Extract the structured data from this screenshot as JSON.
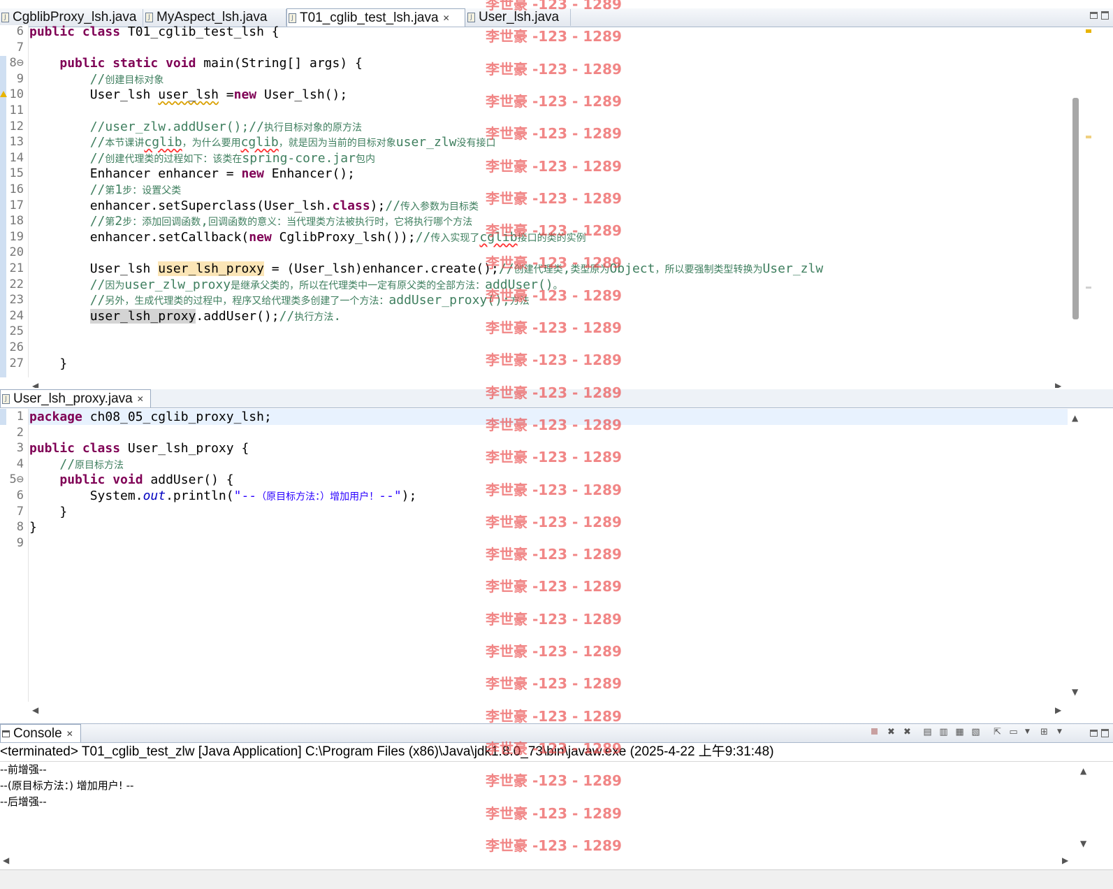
{
  "editor_tabs": [
    {
      "label": "CgblibProxy_lsh.java",
      "active": false
    },
    {
      "label": "MyAspect_lsh.java",
      "active": false
    },
    {
      "label": "T01_cglib_test_lsh.java",
      "active": true
    },
    {
      "label": "User_lsh.java",
      "active": false
    }
  ],
  "editor1": {
    "lines": [
      {
        "n": "6",
        "html": "<span class=\"kw\">public class</span> T01_cglib_test_lsh {"
      },
      {
        "n": "7",
        "html": ""
      },
      {
        "n": "8⊖",
        "html": "    <span class=\"kw\">public static void</span> main(String[] args) {"
      },
      {
        "n": "9",
        "html": "        <span class=\"cm\">//</span><span class=\"cmc\">创建目标对象</span>"
      },
      {
        "n": "10",
        "html": "        User_lsh <span class=\"squig\">user_lsh</span> =<span class=\"kw\">new</span> User_lsh();"
      },
      {
        "n": "11",
        "html": ""
      },
      {
        "n": "12",
        "html": "        <span class=\"cm\">//user_zlw.addUser();//</span><span class=\"cmc\">执行目标对象的原方法</span>"
      },
      {
        "n": "13",
        "html": "        <span class=\"cm\">//</span><span class=\"cmc\">本节课讲</span><span class=\"cm squigr\">cglib</span><span class=\"cmc\">，为什么要用</span><span class=\"cm squigr\">cglib</span><span class=\"cmc\">，就是因为当前的目标对象</span><span class=\"cm\">user_zlw</span><span class=\"cmc\">没有接口</span>"
      },
      {
        "n": "14",
        "html": "        <span class=\"cm\">//</span><span class=\"cmc\">创建代理类的过程如下：该类在</span><span class=\"cm\">spring-core.jar</span><span class=\"cmc\">包内</span>"
      },
      {
        "n": "15",
        "html": "        Enhancer enhancer = <span class=\"kw\">new</span> Enhancer();"
      },
      {
        "n": "16",
        "html": "        <span class=\"cm\">//</span><span class=\"cmc\">第</span><span class=\"cm\">1</span><span class=\"cmc\">步：设置父类</span>"
      },
      {
        "n": "17",
        "html": "        enhancer.setSuperclass(User_lsh.<span class=\"kw\">class</span>);<span class=\"cm\">//</span><span class=\"cmc\">传入参数为目标类</span>"
      },
      {
        "n": "18",
        "html": "        <span class=\"cm\">//</span><span class=\"cmc\">第</span><span class=\"cm\">2</span><span class=\"cmc\">步：添加回调函数</span><span class=\"cm\">,</span><span class=\"cmc\">回调函数的意义：当代理类方法被执行时，它将执行哪个方法</span>"
      },
      {
        "n": "19",
        "html": "        enhancer.setCallback(<span class=\"kw\">new</span> CglibProxy_lsh());<span class=\"cm\">//</span><span class=\"cmc\">传入实现了</span><span class=\"cm squigr\">cglib</span><span class=\"cmc\">接口的类的实例</span>"
      },
      {
        "n": "20",
        "html": ""
      },
      {
        "n": "21",
        "html": "        User_lsh <span class=\"hlw\">user_lsh_proxy</span> = (User_lsh)enhancer.create();<span class=\"cm\">//</span><span class=\"cmc\">创建代理类</span><span class=\"cm\">,</span><span class=\"cmc\">类型原为</span><span class=\"cm\">Object</span><span class=\"cmc\">，所以要强制类型转换为</span><span class=\"cm\">User_zlw</span>"
      },
      {
        "n": "22",
        "html": "        <span class=\"cm\">//</span><span class=\"cmc\">因为</span><span class=\"cm\">user_zlw_proxy</span><span class=\"cmc\">是继承父类的，所以在代理类中一定有原父类的全部方法：</span><span class=\"cm\">addUser()</span><span class=\"cmc\">。</span>"
      },
      {
        "n": "23",
        "html": "        <span class=\"cm\">//</span><span class=\"cmc\">另外，生成代理类的过程中，程序又给代理类多创建了一个方法：</span><span class=\"cm\">addUser_proxy();</span><span class=\"cmc\">方法</span>"
      },
      {
        "n": "24",
        "html": "        <span class=\"hlr\">user_lsh_proxy</span>.addUser();<span class=\"cm\">//</span><span class=\"cmc\">执行方法</span><span class=\"cm\">.</span>"
      },
      {
        "n": "25",
        "html": ""
      },
      {
        "n": "26",
        "html": ""
      },
      {
        "n": "27",
        "html": "    }"
      }
    ]
  },
  "editor2_tab": {
    "label": "User_lsh_proxy.java"
  },
  "editor2": {
    "lines": [
      {
        "n": "1",
        "html": "<span class=\"kw\">package</span> ch08_05_cglib_proxy_lsh;"
      },
      {
        "n": "2",
        "html": ""
      },
      {
        "n": "3",
        "html": "<span class=\"kw\">public class</span> User_lsh_proxy {"
      },
      {
        "n": "4",
        "html": "    <span class=\"cm\">//</span><span class=\"cmc\">原目标方法</span>"
      },
      {
        "n": "5⊖",
        "html": "    <span class=\"kw\">public void</span> addUser() {"
      },
      {
        "n": "6",
        "html": "        System.<span class=\"fld\">out</span>.println(<span class=\"str\">\"--</span><span class=\"strc\">（原目标方法：）增加用户！</span><span class=\"str\">--\"</span>);"
      },
      {
        "n": "7",
        "html": "    }"
      },
      {
        "n": "8",
        "html": "}"
      },
      {
        "n": "9",
        "html": ""
      }
    ]
  },
  "console": {
    "tab_label": "Console",
    "status": "<terminated> T01_cglib_test_zlw [Java Application] C:\\Program Files (x86)\\Java\\jdk1.8.0_73\\bin\\javaw.exe (2025-4-22 上午9:31:48)",
    "output": [
      "--前增强--",
      "--(原目标方法：) 增加用户! --",
      "--后增强--"
    ]
  },
  "watermark": {
    "text": "李世豪 -123 - 1289",
    "color": "#eb4646"
  }
}
